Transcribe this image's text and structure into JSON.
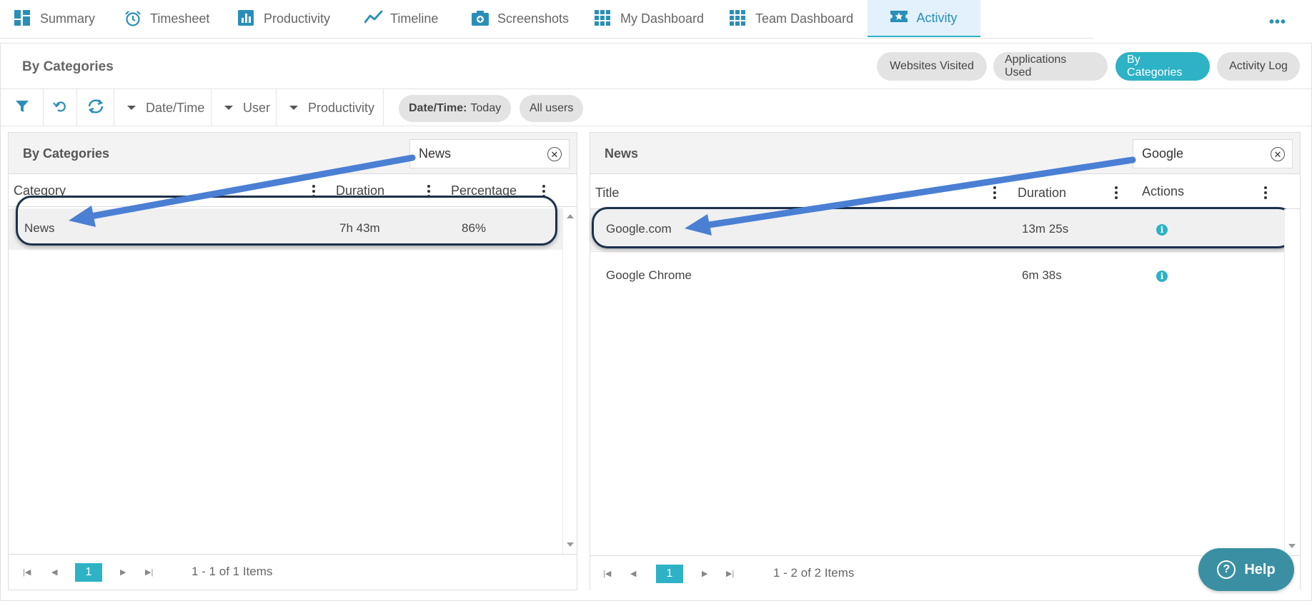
{
  "nav": {
    "tabs": [
      {
        "label": "Summary",
        "icon": "summary-grid-icon"
      },
      {
        "label": "Timesheet",
        "icon": "alarm-clock-icon"
      },
      {
        "label": "Productivity",
        "icon": "bar-chart-icon"
      },
      {
        "label": "Timeline",
        "icon": "line-chart-icon"
      },
      {
        "label": "Screenshots",
        "icon": "camera-icon"
      },
      {
        "label": "My Dashboard",
        "icon": "dashboard-grid-icon"
      },
      {
        "label": "Team Dashboard",
        "icon": "dashboard-grid-icon"
      },
      {
        "label": "Activity",
        "icon": "ticket-star-icon",
        "active": true
      }
    ],
    "more": "•••"
  },
  "page": {
    "title": "By Categories",
    "views": [
      "Websites Visited",
      "Applications Used",
      "By Categories",
      "Activity Log"
    ],
    "active_view": "By Categories"
  },
  "toolbar": {
    "filters": [
      "Date/Time",
      "User",
      "Productivity"
    ],
    "chip_date_key": "Date/Time:",
    "chip_date_value": "Today",
    "chip_users": "All users"
  },
  "left_card": {
    "title": "By Categories",
    "search_value": "News",
    "columns": [
      "Category",
      "Duration",
      "Percentage"
    ],
    "rows": [
      {
        "category": "News",
        "duration": "7h 43m",
        "percentage": "86%"
      }
    ],
    "pager": {
      "page": "1",
      "info": "1 - 1 of 1 Items"
    }
  },
  "right_card": {
    "title": "News",
    "search_value": "Google",
    "columns": [
      "Title",
      "Duration",
      "Actions"
    ],
    "rows": [
      {
        "title": "Google.com",
        "duration": "13m 25s"
      },
      {
        "title": "Google Chrome",
        "duration": "6m 38s"
      }
    ],
    "pager": {
      "page": "1",
      "info": "1 - 2 of 2 Items"
    }
  },
  "help": {
    "label": "Help",
    "icon": "question-circle-icon"
  },
  "colors": {
    "accent": "#2db2c6",
    "nav_icon": "#2a8fb8",
    "arrow": "#4a7fd4",
    "ring": "#1d3049"
  }
}
